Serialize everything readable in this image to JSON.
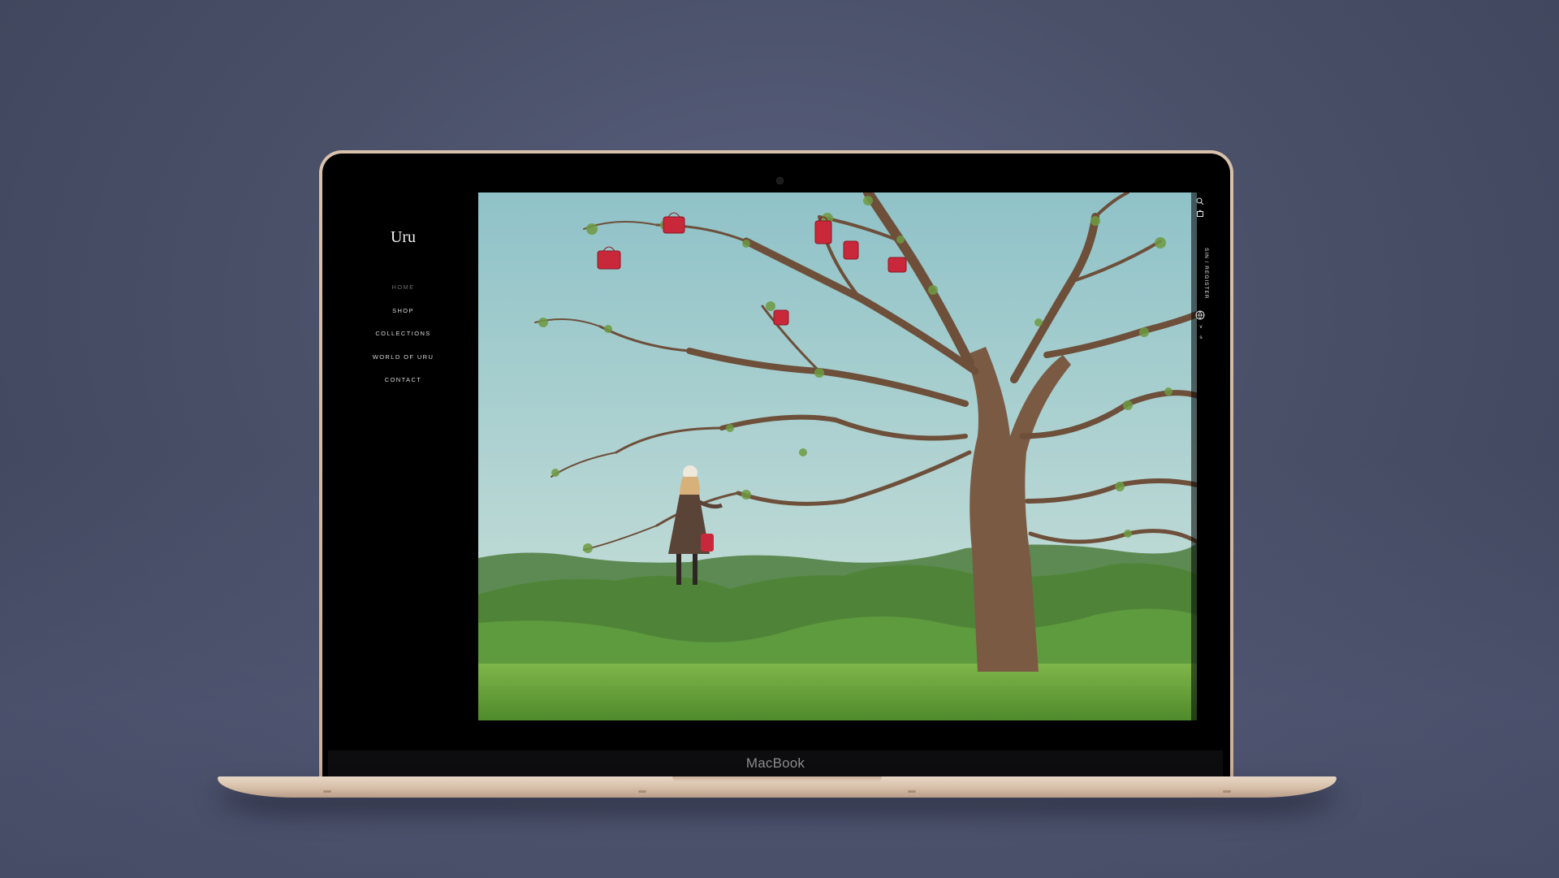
{
  "device": {
    "label": "MacBook"
  },
  "site": {
    "logo": "Uru",
    "nav": [
      {
        "label": "HOME",
        "active": true
      },
      {
        "label": "SHOP",
        "active": false
      },
      {
        "label": "COLLECTIONS",
        "active": false
      },
      {
        "label": "WORLD OF URU",
        "active": false
      },
      {
        "label": "CONTACT",
        "active": false
      }
    ],
    "utility": {
      "signin_label": "SIN / REGISTER",
      "lang_a": "v",
      "lang_b": "s"
    },
    "hero_image": "woman with red handbag under tree with red bags on green hills"
  },
  "colors": {
    "background": "#4a5068",
    "laptop_gold": "#d9c2ad",
    "sky": "#aacdd2",
    "hills": "#5e8a45",
    "grass": "#78b040",
    "bags": "#c8283a"
  }
}
